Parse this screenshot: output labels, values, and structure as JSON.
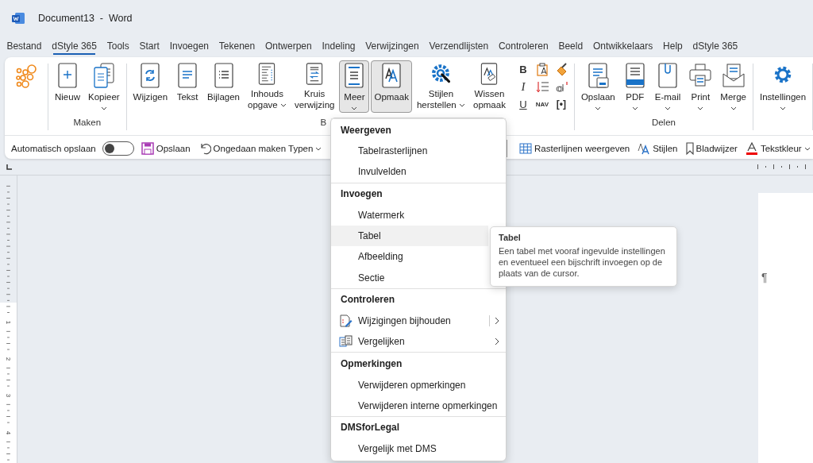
{
  "window": {
    "title": "Document13  -  Word"
  },
  "menu_tabs": [
    {
      "label": "Bestand",
      "selected": false
    },
    {
      "label": "dStyle 365",
      "selected": true
    },
    {
      "label": "Tools",
      "selected": false
    },
    {
      "label": "Start",
      "selected": false
    },
    {
      "label": "Invoegen",
      "selected": false
    },
    {
      "label": "Tekenen",
      "selected": false
    },
    {
      "label": "Ontwerpen",
      "selected": false
    },
    {
      "label": "Indeling",
      "selected": false
    },
    {
      "label": "Verwijzingen",
      "selected": false
    },
    {
      "label": "Verzendlijsten",
      "selected": false
    },
    {
      "label": "Controleren",
      "selected": false
    },
    {
      "label": "Beeld",
      "selected": false
    },
    {
      "label": "Ontwikkelaars",
      "selected": false
    },
    {
      "label": "Help",
      "selected": false
    },
    {
      "label": "dStyle 365",
      "selected": false
    }
  ],
  "ribbon": {
    "groups": [
      {
        "kind": "logo"
      },
      {
        "kind": "buttons",
        "label": "Maken",
        "items": [
          {
            "kind": "large",
            "label": "Nieuw",
            "dropdown": false,
            "pressed": false
          },
          {
            "kind": "large",
            "label": "Kopieer",
            "dropdown": true,
            "pressed": false
          }
        ]
      },
      {
        "kind": "buttons",
        "label": "B",
        "items": [
          {
            "kind": "large",
            "label": "Wijzigen",
            "dropdown": false,
            "pressed": false
          },
          {
            "kind": "large",
            "label": "Tekst",
            "dropdown": false,
            "pressed": false
          },
          {
            "kind": "large",
            "label": "Bijlagen",
            "dropdown": false,
            "pressed": false
          },
          {
            "kind": "large",
            "label": "Inhouds\nopgave",
            "dropdown": true,
            "pressed": false
          },
          {
            "kind": "large",
            "label": "Kruis\nverwijzing",
            "dropdown": false,
            "pressed": false
          },
          {
            "kind": "large",
            "label": "Meer",
            "dropdown": true,
            "pressed": true
          },
          {
            "kind": "large",
            "label": "Opmaak",
            "dropdown": false,
            "pressed": true
          },
          {
            "kind": "large",
            "label": "Stijlen\nherstellen",
            "dropdown": true,
            "pressed": false
          },
          {
            "kind": "large",
            "label": "Wissen\nopmaak",
            "dropdown": false,
            "pressed": false
          },
          {
            "kind": "bold",
            "label": "B"
          },
          {
            "kind": "italic",
            "label": "I"
          },
          {
            "kind": "underline",
            "label": "U"
          },
          {
            "kind": "icon"
          },
          {
            "kind": "icon"
          },
          {
            "kind": "caps",
            "label": "NAV"
          },
          {
            "kind": "icon"
          },
          {
            "kind": "icon"
          },
          {
            "kind": "code",
            "label": "[•]"
          }
        ]
      },
      {
        "kind": "buttons",
        "label": "Delen",
        "items": [
          {
            "kind": "large",
            "label": "Opslaan",
            "dropdown": true,
            "pressed": false
          },
          {
            "kind": "large",
            "label": "PDF",
            "dropdown": true,
            "pressed": false
          },
          {
            "kind": "large",
            "label": "E-mail",
            "dropdown": true,
            "pressed": false
          },
          {
            "kind": "large",
            "label": "Print",
            "dropdown": true,
            "pressed": false
          },
          {
            "kind": "large",
            "label": "Merge",
            "dropdown": true,
            "pressed": false
          }
        ]
      },
      {
        "kind": "buttons",
        "items": [
          {
            "kind": "large",
            "label": "Instellingen",
            "dropdown": true,
            "pressed": false
          }
        ]
      }
    ]
  },
  "toolbar": {
    "left": [
      {
        "kind": "toggle",
        "label": "Automatisch opslaan",
        "on": false
      },
      {
        "kind": "button",
        "label": "Opslaan",
        "dropdown": false
      },
      {
        "kind": "button",
        "label": "Ongedaan maken Typen",
        "dropdown": true
      }
    ],
    "right": [
      {
        "kind": "button",
        "label": "Rasterlijnen weergeven",
        "dropdown": false
      },
      {
        "kind": "button",
        "label": "Stijlen",
        "dropdown": false
      },
      {
        "kind": "button",
        "label": "Bladwijzer",
        "dropdown": false
      },
      {
        "kind": "button",
        "label": "Tekstkleur",
        "dropdown": true
      }
    ]
  },
  "document": {
    "ruler_numbers": [
      "1",
      "2",
      "3",
      "4"
    ],
    "page_text": "¶"
  },
  "menu": {
    "sections": [
      {
        "title": "Weergeven",
        "items": [
          {
            "label": "Tabelrasterlijnen",
            "kind": "plain",
            "selected": false,
            "submenu": false,
            "split": false
          },
          {
            "label": "Invulvelden",
            "kind": "plain",
            "selected": false,
            "submenu": false,
            "split": false
          }
        ]
      },
      {
        "title": "Invoegen",
        "items": [
          {
            "label": "Watermerk",
            "kind": "plain",
            "selected": false,
            "submenu": false,
            "split": false
          },
          {
            "label": "Tabel",
            "kind": "plain",
            "selected": true,
            "submenu": false,
            "split": false
          },
          {
            "label": "Afbeelding",
            "kind": "plain",
            "selected": false,
            "submenu": false,
            "split": false
          },
          {
            "label": "Sectie",
            "kind": "plain",
            "selected": false,
            "submenu": false,
            "split": false
          }
        ]
      },
      {
        "title": "Controleren",
        "items": [
          {
            "label": "Wijzigingen bijhouden",
            "kind": "icon",
            "selected": false,
            "submenu": true,
            "split": true
          },
          {
            "label": "Vergelijken",
            "kind": "icon",
            "selected": false,
            "submenu": true,
            "split": false
          }
        ]
      },
      {
        "title": "Opmerkingen",
        "items": [
          {
            "label": "Verwijderen opmerkingen",
            "kind": "plain",
            "selected": false,
            "submenu": false,
            "split": false
          },
          {
            "label": "Verwijderen interne opmerkingen",
            "kind": "plain",
            "selected": false,
            "submenu": false,
            "split": false
          }
        ]
      },
      {
        "title": "DMSforLegal",
        "items": [
          {
            "label": "Vergelijk met DMS",
            "kind": "plain",
            "selected": false,
            "submenu": false,
            "split": false
          }
        ]
      }
    ]
  },
  "tooltip": {
    "title": "Tabel",
    "text": "Een tabel met vooraf ingevulde instellingen en eventueel een bijschrift invoegen op de plaats van de cursor."
  }
}
